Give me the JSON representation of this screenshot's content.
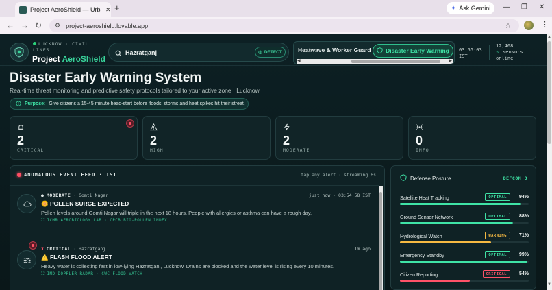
{
  "browser": {
    "tab_title": "Project AeroShield — Urban Civil Lines",
    "tab_close": "✕",
    "new_tab": "+",
    "gemini_label": "Ask Gemini",
    "url": "project-aeroshield.lovable.app",
    "win_min": "—",
    "win_max": "❐",
    "win_close": "✕"
  },
  "header": {
    "location": "LUCKNOW · CIVIL LINES",
    "brand_prefix": "Project ",
    "brand_accent": "AeroShield",
    "search_value": "Hazratganj",
    "detect_label": "DETECT",
    "mode_1": "Heatwave & Worker Guard",
    "mode_2": "Disaster Early Warning",
    "clock_time": "03:55:03",
    "clock_zone": "IST",
    "sensors_count": "12,408",
    "sensors_label": "sensors online"
  },
  "hero": {
    "title": "Disaster Early Warning System",
    "subtitle": "Real-time threat monitoring and predictive safety protocols tailored to your active zone · Lucknow.",
    "purpose_label": "Purpose:",
    "purpose_text": "Give citizens a 15-45 minute head-start before floods, storms and heat spikes hit their street."
  },
  "stats": [
    {
      "value": "2",
      "label": "CRITICAL",
      "icon": "siren-icon"
    },
    {
      "value": "2",
      "label": "HIGH",
      "icon": "warning-triangle-icon"
    },
    {
      "value": "2",
      "label": "MODERATE",
      "icon": "lightning-icon"
    },
    {
      "value": "0",
      "label": "INFO",
      "icon": "broadcast-icon"
    }
  ],
  "feed": {
    "title": "ANOMALOUS EVENT FEED · IST",
    "hint": "tap any alert · streaming 6s",
    "alerts": [
      {
        "severity": "MODERATE",
        "location": "· Gomti Nagar",
        "time": "just now · 03:54:58 IST",
        "emoji": "🌼",
        "headline": "POLLEN SURGE EXPECTED",
        "body": "Pollen levels around Gomti Nagar will triple in the next 18 hours. People with allergies or asthma can have a rough day.",
        "sources": "ICMR AEROBIOLOGY LAB · CPCB BIO-POLLEN INDEX",
        "icon": "cloud-icon"
      },
      {
        "severity": "CRITICAL",
        "location": "· Hazratganj",
        "time": "1m ago",
        "emoji": "⚠️",
        "headline": "FLASH FLOOD ALERT",
        "body": "Heavy water is collecting fast in low-lying Hazratganj, Lucknow. Drains are blocked and the water level is rising every 10 minutes.",
        "sources": "IMD DOPPLER RADAR · CWC FLOOD WATCH",
        "icon": "waves-icon"
      }
    ]
  },
  "posture": {
    "title": "Defense Posture",
    "defcon": "DEFCON 3",
    "rows": [
      {
        "name": "Satellite Heat Tracking",
        "status": "OPTIMAL",
        "pct": "94%",
        "value": 94
      },
      {
        "name": "Ground Sensor Network",
        "status": "OPTIMAL",
        "pct": "88%",
        "value": 88
      },
      {
        "name": "Hydrological Watch",
        "status": "WARNING",
        "pct": "71%",
        "value": 71
      },
      {
        "name": "Emergency Standby",
        "status": "OPTIMAL",
        "pct": "99%",
        "value": 99
      },
      {
        "name": "Citizen Reporting",
        "status": "CRITICAL",
        "pct": "54%",
        "value": 54
      }
    ]
  },
  "colors": {
    "optimal": "#3fe3a6",
    "warning": "#f5b942",
    "critical": "#ff5268",
    "accent": "#38d39a",
    "background": "#0b1a1c"
  }
}
